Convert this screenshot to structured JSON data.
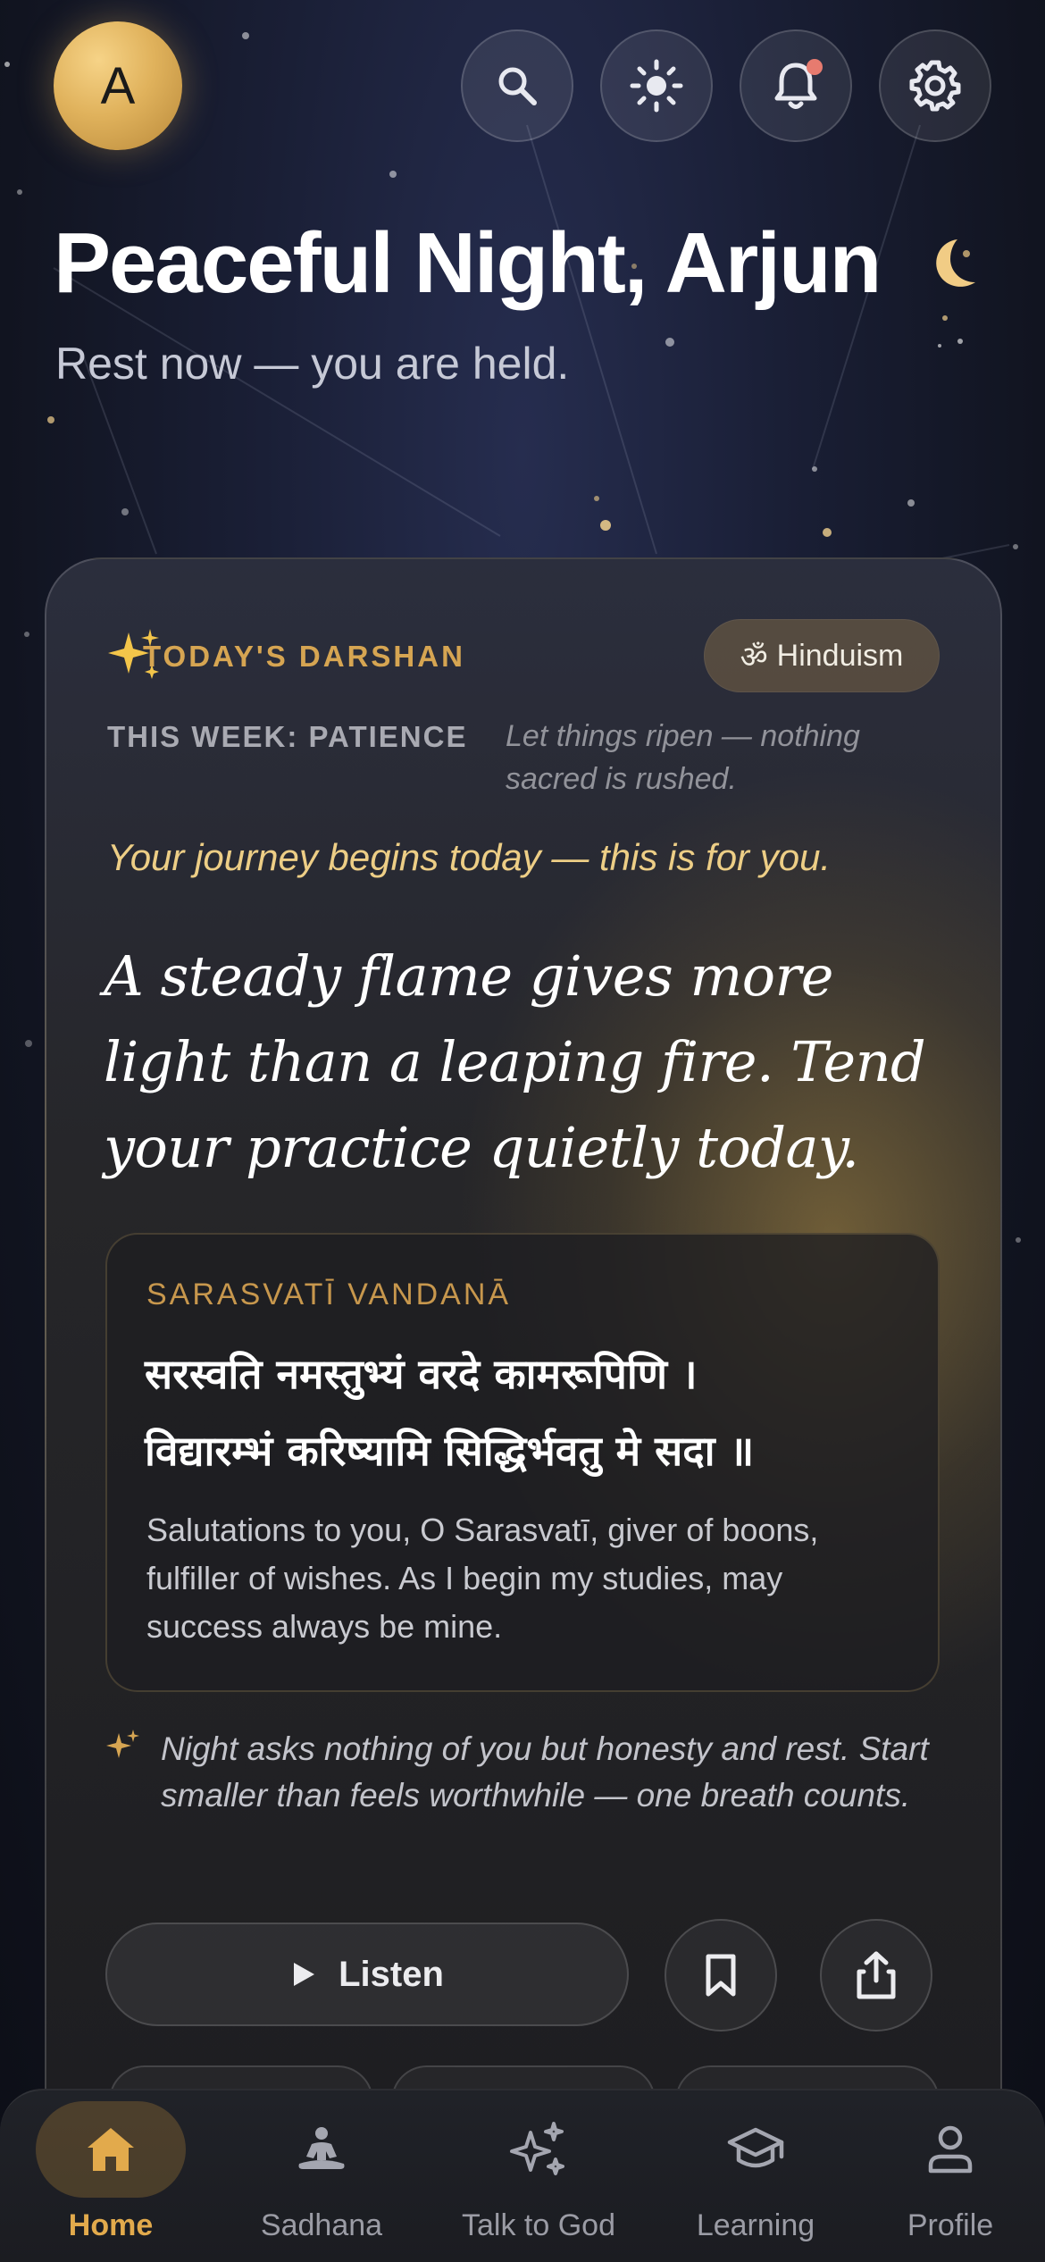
{
  "header": {
    "avatar_initial": "A",
    "greeting": "Peaceful Night, Arjun",
    "subtitle": "Rest now — you are held."
  },
  "darshan": {
    "label": "TODAY'S DARSHAN",
    "tradition_pill": "Hinduism",
    "week_label": "THIS WEEK: PATIENCE",
    "week_note": "Let things ripen — nothing sacred is rushed.",
    "journey_note": "Your journey begins today — this is for you.",
    "quote": "A steady flame gives more light than a leaping fire. Tend your practice quietly today.",
    "mantra": {
      "title": "SARASVATĪ VANDANĀ",
      "line1": "सरस्वति नमस्तुभ्यं वरदे कामरूपिणि ।",
      "line2": "विद्यारम्भं करिष्यामि सिद्धिर्भवतु मे सदा ॥",
      "translation": "Salutations to you, O Sarasvatī, giver of boons, fulfiller of wishes. As I begin my studies, may success always be mine."
    },
    "reflection": "Night asks nothing of you but honesty and rest. Start smaller than feels worthwhile — one breath counts.",
    "listen_label": "Listen"
  },
  "nav": {
    "items": [
      {
        "label": "Home",
        "icon": "home-icon",
        "active": true
      },
      {
        "label": "Sadhana",
        "icon": "meditation-icon",
        "active": false
      },
      {
        "label": "Talk to God",
        "icon": "sparkles-icon",
        "active": false
      },
      {
        "label": "Learning",
        "icon": "graduation-cap-icon",
        "active": false
      },
      {
        "label": "Profile",
        "icon": "person-icon",
        "active": false
      }
    ]
  },
  "colors": {
    "accent_gold": "#d6a552",
    "journey_text": "#edce86",
    "notification_dot": "#e77b6f",
    "background": "#1a1f36"
  }
}
